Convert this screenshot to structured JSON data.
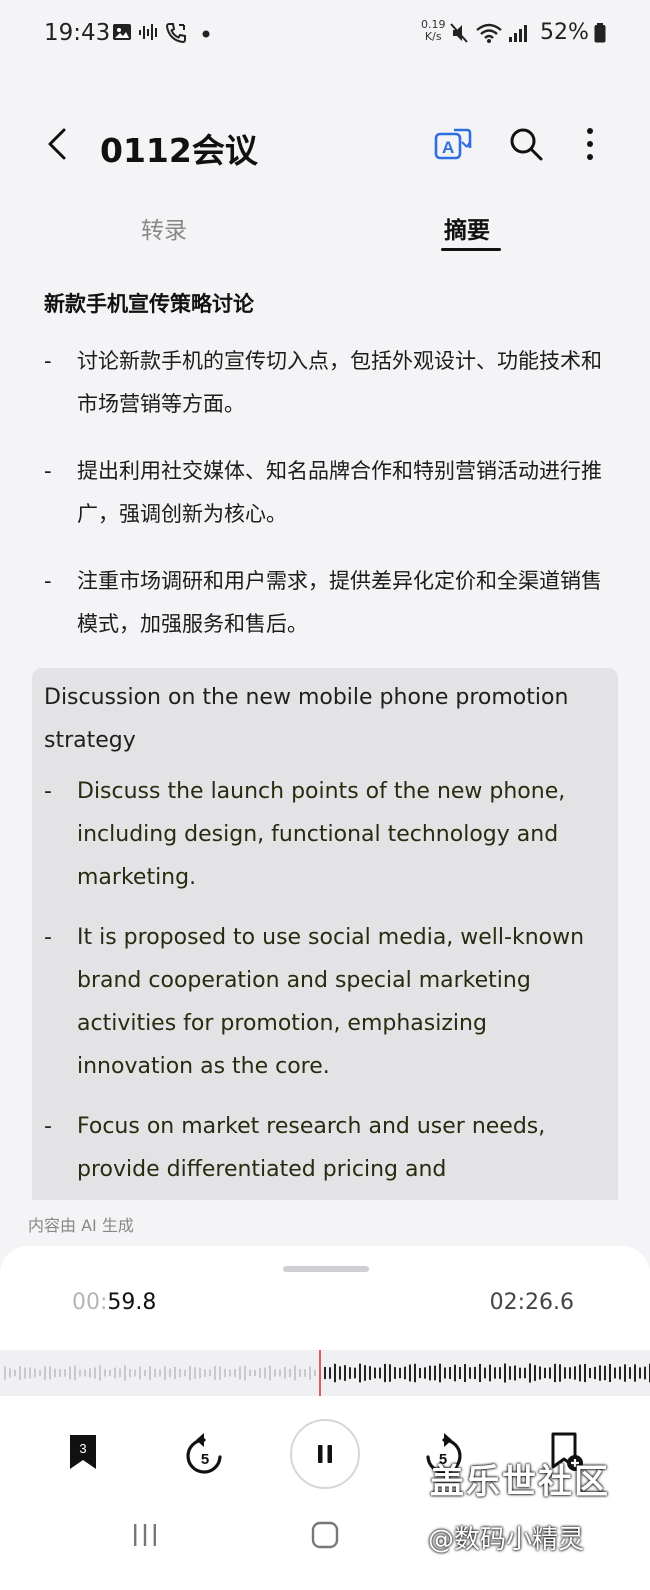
{
  "status_bar": {
    "time": "19:43",
    "net_speed_value": "0.19",
    "net_speed_unit": "K/s",
    "battery": "52%"
  },
  "header": {
    "title": "0112会议",
    "icons": [
      "back-icon",
      "translate-icon",
      "search-icon",
      "more-options-icon"
    ]
  },
  "tabs": [
    {
      "label": "转录",
      "active": false
    },
    {
      "label": "摘要",
      "active": true
    }
  ],
  "summary": {
    "title": "新款手机宣传策略讨论",
    "bullets": [
      "讨论新款手机的宣传切入点，包括外观设计、功能技术和市场营销等方面。",
      "提出利用社交媒体、知名品牌合作和特别营销活动进行推广，强调创新为核心。",
      "注重市场调研和用户需求，提供差异化定价和全渠道销售模式，加强服务和售后。"
    ]
  },
  "translation": {
    "title": "Discussion on the new mobile phone promotion strategy",
    "bullets": [
      "Discuss the launch points of the new phone, including design, functional technology and marketing.",
      "It is proposed to use social media, well-known brand cooperation and special marketing activities for promotion, emphasizing innovation as the core.",
      "Focus on market research and user needs, provide differentiated pricing and"
    ]
  },
  "ai_note": "内容由 AI 生成",
  "player": {
    "time_current_prefix": "00:",
    "time_current_value": "59.8",
    "time_total": "02:26.6",
    "progress_fraction": 0.4,
    "bookmark_count": "3",
    "rewind_seconds": "5",
    "forward_seconds": "5"
  },
  "watermark": {
    "line1": "盖乐世社区",
    "line2": "@数码小精灵"
  },
  "colors": {
    "background": "#f4f4f7",
    "translation_box": "#e3e3e6",
    "accent_blue": "#2f6ee0",
    "playhead": "#e05a5a"
  }
}
